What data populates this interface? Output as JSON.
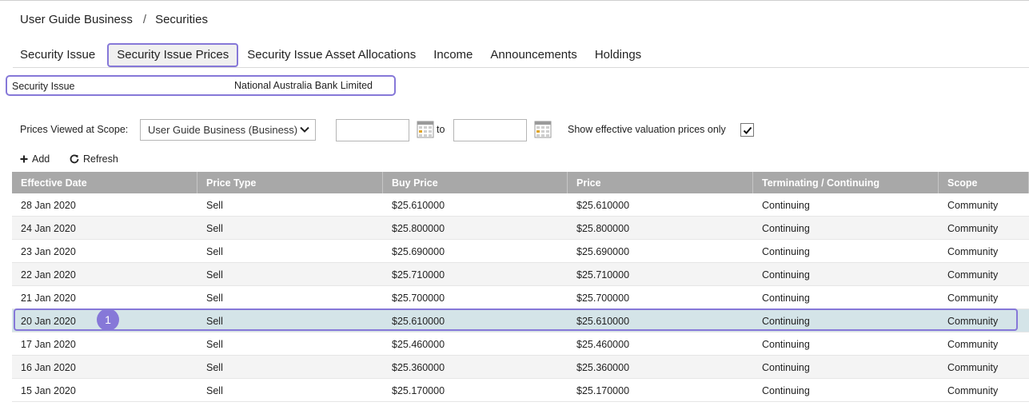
{
  "breadcrumb": {
    "parent": "User Guide Business",
    "separator": "/",
    "current": "Securities"
  },
  "tabs": [
    {
      "label": "Security Issue"
    },
    {
      "label": "Security Issue Prices"
    },
    {
      "label": "Security Issue Asset Allocations"
    },
    {
      "label": "Income"
    },
    {
      "label": "Announcements"
    },
    {
      "label": "Holdings"
    }
  ],
  "active_tab": "Security Issue Prices",
  "security_issue": {
    "label": "Security Issue",
    "value": "National Australia Bank Limited"
  },
  "filters": {
    "scope_label": "Prices Viewed at Scope:",
    "scope_value": "User Guide Business (Business)",
    "from_date": "",
    "to_label": "to",
    "to_date": "",
    "effective_only_label": "Show effective valuation prices only",
    "effective_only_checked": true
  },
  "actions": {
    "add": "Add",
    "refresh": "Refresh"
  },
  "table": {
    "columns": [
      "Effective Date",
      "Price Type",
      "Buy Price",
      "Price",
      "Terminating / Continuing",
      "Scope"
    ],
    "rows": [
      [
        "28 Jan 2020",
        "Sell",
        "$25.610000",
        "$25.610000",
        "Continuing",
        "Community"
      ],
      [
        "24 Jan 2020",
        "Sell",
        "$25.800000",
        "$25.800000",
        "Continuing",
        "Community"
      ],
      [
        "23 Jan 2020",
        "Sell",
        "$25.690000",
        "$25.690000",
        "Continuing",
        "Community"
      ],
      [
        "22 Jan 2020",
        "Sell",
        "$25.710000",
        "$25.710000",
        "Continuing",
        "Community"
      ],
      [
        "21 Jan 2020",
        "Sell",
        "$25.700000",
        "$25.700000",
        "Continuing",
        "Community"
      ],
      [
        "20 Jan 2020",
        "Sell",
        "$25.610000",
        "$25.610000",
        "Continuing",
        "Community"
      ],
      [
        "17 Jan 2020",
        "Sell",
        "$25.460000",
        "$25.460000",
        "Continuing",
        "Community"
      ],
      [
        "16 Jan 2020",
        "Sell",
        "$25.360000",
        "$25.360000",
        "Continuing",
        "Community"
      ],
      [
        "15 Jan 2020",
        "Sell",
        "$25.170000",
        "$25.170000",
        "Continuing",
        "Community"
      ]
    ],
    "selected_row": 5
  },
  "annotation": {
    "badge": "1"
  },
  "colors": {
    "highlight": "#8678d8",
    "header_bg": "#a8a8a8",
    "selected_row": "#d4e4e8"
  },
  "icons": {
    "add": "plus-icon",
    "refresh": "refresh-icon",
    "calendar": "calendar-icon",
    "dropdown": "chevron-down-icon",
    "checkbox": "check-icon"
  }
}
